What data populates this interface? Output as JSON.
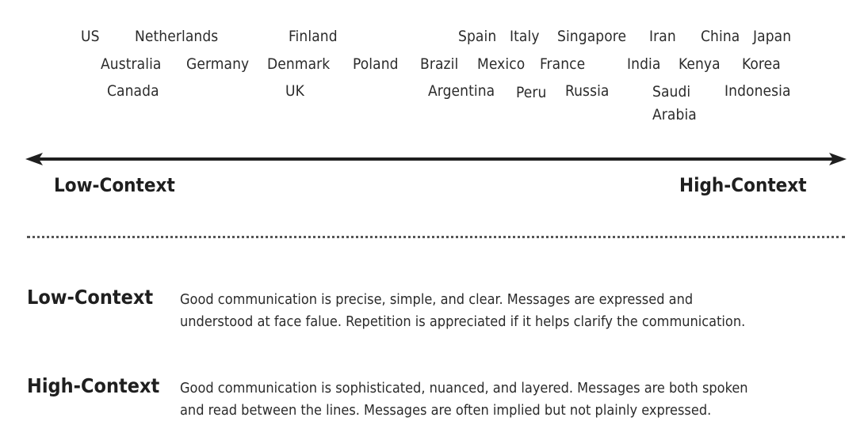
{
  "countries": [
    {
      "id": "us",
      "name": "US"
    },
    {
      "id": "netherlands",
      "name": "Netherlands"
    },
    {
      "id": "finland",
      "name": "Finland"
    },
    {
      "id": "spain",
      "name": "Spain"
    },
    {
      "id": "italy",
      "name": "Italy"
    },
    {
      "id": "singapore",
      "name": "Singapore"
    },
    {
      "id": "iran",
      "name": "Iran"
    },
    {
      "id": "china",
      "name": "China"
    },
    {
      "id": "japan",
      "name": "Japan"
    },
    {
      "id": "australia",
      "name": "Australia"
    },
    {
      "id": "germany",
      "name": "Germany"
    },
    {
      "id": "denmark",
      "name": "Denmark"
    },
    {
      "id": "poland",
      "name": "Poland"
    },
    {
      "id": "brazil",
      "name": "Brazil"
    },
    {
      "id": "mexico",
      "name": "Mexico"
    },
    {
      "id": "france",
      "name": "France"
    },
    {
      "id": "india",
      "name": "India"
    },
    {
      "id": "kenya",
      "name": "Kenya"
    },
    {
      "id": "korea",
      "name": "Korea"
    },
    {
      "id": "canada",
      "name": "Canada"
    },
    {
      "id": "uk",
      "name": "UK"
    },
    {
      "id": "argentina",
      "name": "Argentina"
    },
    {
      "id": "peru",
      "name": "Peru"
    },
    {
      "id": "russia",
      "name": "Russia"
    },
    {
      "id": "saudi_arabia",
      "name_line1": "Saudi",
      "name_line2": "Arabia"
    },
    {
      "id": "indonesia",
      "name": "Indonesia"
    }
  ],
  "scale": {
    "low_label": "Low-Context",
    "high_label": "High-Context",
    "arrow_color": "#1f1f1f"
  },
  "definitions": [
    {
      "term": "Low-Context",
      "line1": "Good communication is precise, simple, and clear. Messages are expressed and",
      "line2": "understood at face falue. Repetition is appreciated if it helps clarify the communication."
    },
    {
      "term": "High-Context",
      "line1": "Good communication is sophisticated, nuanced, and layered. Messages are both spoken",
      "line2": "and read between the lines. Messages are often implied but not plainly expressed."
    }
  ]
}
